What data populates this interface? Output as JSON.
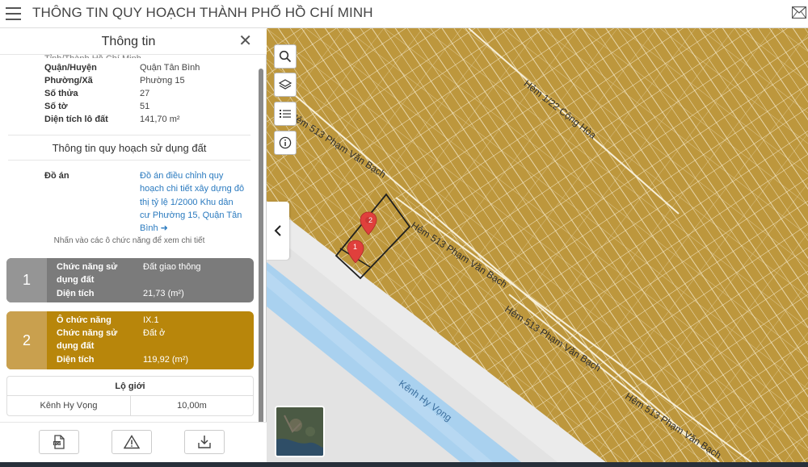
{
  "app": {
    "title": "THÔNG TIN QUY HOẠCH THÀNH PHỐ HỒ CHÍ MINH",
    "menu_icon": "hamburger-menu-icon",
    "mail_icon": "mail-icon"
  },
  "panel": {
    "title": "Thông tin",
    "close_icon": "close-icon",
    "cut_row": "Tỉnh/Thành           Hồ Chí Minh",
    "rows": [
      {
        "key": "Quận/Huyện",
        "value": "Quận Tân Bình"
      },
      {
        "key": "Phường/Xã",
        "value": "Phường 15"
      },
      {
        "key": "Số thửa",
        "value": "27"
      },
      {
        "key": "Số tờ",
        "value": "51"
      },
      {
        "key": "Diện tích lô đất",
        "value": "141,70 m²"
      }
    ],
    "section_title": "Thông tin quy hoạch sử dụng đất",
    "do_an_label": "Đồ án",
    "do_an_link": "Đồ án điều chỉnh quy hoạch chi tiết xây dựng đô thị tỷ lệ 1/2000 Khu dân cư Phường 15, Quận Tân Bình ➜",
    "hint": "Nhấn vào các ô chức năng để xem chi tiết",
    "cards": [
      {
        "number": "1",
        "rows": [
          {
            "key": "Chức năng sử dụng đất",
            "value": "Đất giao thông"
          },
          {
            "key": "Diện tích",
            "value": "21,73 (m²)"
          }
        ],
        "color": "#7b7b7b"
      },
      {
        "number": "2",
        "rows": [
          {
            "key": "Ô chức năng",
            "value": "IX.1"
          },
          {
            "key": "Chức năng sử dụng đất",
            "value": "Đất ở"
          },
          {
            "key": "Diện tích",
            "value": "119,92 (m²)"
          }
        ],
        "color": "#b8860b"
      }
    ],
    "lo_gioi": {
      "header": "Lộ giới",
      "name": "Kênh Hy Vọng",
      "width": "10,00m"
    },
    "bottom_icons": [
      "pdf-document-icon",
      "warning-icon",
      "download-icon"
    ]
  },
  "map": {
    "tool_icons": [
      "search-icon",
      "layers-icon",
      "list-icon",
      "info-icon"
    ],
    "collapse_icon": "chevron-left-icon",
    "labels": [
      "Hẻm 513 Phạm Văn Bạch",
      "Hẻm 513 Phạm Văn Bạch",
      "Hẻm 513 Phạm Văn Bạch",
      "Hẻm 513 Phạm Văn Bạch",
      "Hẻm 1/22 Cộng Hòa",
      "Kênh Hy Vọng"
    ],
    "markers": [
      "2",
      "1"
    ],
    "colors": {
      "land": "#bd973d",
      "road": "#ebebeb",
      "water": "#a9d1ef",
      "parcel_line": "#f3e7c9",
      "marker": "#e0403c"
    }
  }
}
